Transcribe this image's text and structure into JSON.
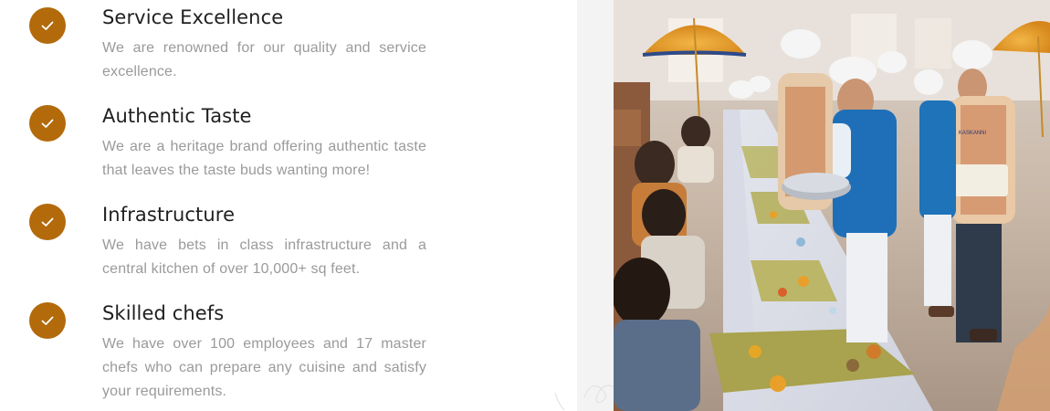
{
  "features": [
    {
      "title": "Service Excellence",
      "description": "We are renowned for our quality and service excellence.",
      "icon": "check-icon"
    },
    {
      "title": "Authentic Taste",
      "description": "We are a heritage brand offering authentic taste that leaves the taste buds wanting more!",
      "icon": "check-icon"
    },
    {
      "title": "Infrastructure",
      "description": "We have bets in class infrastructure and a central kitchen of over 10,000+ sq feet.",
      "icon": "check-icon"
    },
    {
      "title": "Skilled chefs",
      "description": "We have over 100 employees and 17 master chefs who can prepare any cuisine and satisfy your requirements.",
      "icon": "check-icon"
    }
  ],
  "colors": {
    "accent": "#b36a0b",
    "title": "#1f1f1f",
    "body_text": "#9a9a9a"
  },
  "photo": {
    "subject": "catering-service-photo",
    "apron_text": "KASKANNI"
  }
}
